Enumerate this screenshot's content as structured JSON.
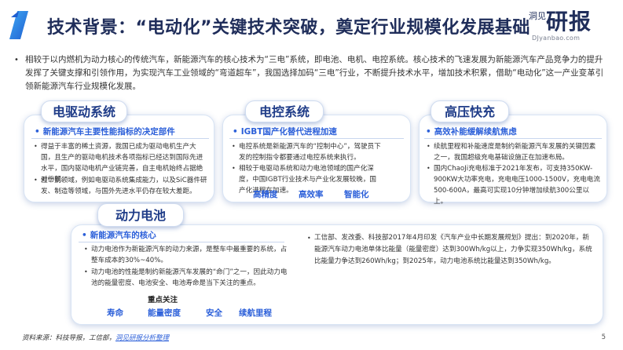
{
  "header": {
    "section_number": "1",
    "title": "技术背景：“电动化”关键技术突破，奠定行业规模化发展基础",
    "logo_small": "洞见",
    "logo_big": "研报",
    "logo_url": "DJyanbao.com"
  },
  "intro": {
    "bullet": "•",
    "text": "相较于以内燃机为动力核心的传统汽车，新能源汽车的核心技术为“三电”系统，即电池、电机、电控系统。核心技术的飞速发展为新能源汽车产品竞争力的提升发挥了关键支撑和引领作用，为实现汽车工业领域的“弯道超车”，我国选择加码“三电”行业，不断提升技术水平，增加技术积累，借助“电动化”这一产业变革引领新能源汽车行业规模化发展。"
  },
  "panels": {
    "motor": {
      "tag": "电驱动系统",
      "subhead": "新能源汽车主要性能指标的决定部件",
      "paragraphs": [
        "得益于丰富的稀土资源，我国已成为驱动电机生产大国，且生产的驱动电机技术各项指标已经达到国际先进水平，国内驱动电机产业链完善，自主电机始终占据绝对份额。",
        "但个别领域，例如电驱动系统集成能力，以及SiC器件研发、制造等领域，与国外先进水平仍存在较大差距。"
      ]
    },
    "control": {
      "tag": "电控系统",
      "subhead": "IGBT国产化替代进程加速",
      "paragraphs": [
        "电控系统是新能源汽车的“控制中心”，驾驶员下发的控制指令都要通过电控系统来执行。",
        "相较于电驱动系统和动力电池领域的国产化深度，中国IGBT行业技术与产业化发展较晚，国产化进程在加速。"
      ],
      "keywords": [
        "高精度",
        "高效率",
        "智能化"
      ]
    },
    "charging": {
      "tag": "高压快充",
      "subhead": "高效补能缓解续航焦虑",
      "paragraphs": [
        "续航里程和补能速度是制约新能源汽车发展的关键因素之一，我国超级充电基础设施正在加速布局。",
        "国内ChaoJi充电标准于2021年发布，可支持350KW-900KW大功率充电，充电电压1000-1500V，充电电流500-600A，最高可实现10分钟增加续航300公里以上。"
      ]
    },
    "battery": {
      "tag": "动力电池",
      "subhead": "新能源汽车的核心",
      "paragraphs_left": [
        "动力电池作为新能源汽车的动力来源，是整车中最重要的系统，占整车成本的30%~40%。",
        "动力电池的性能是制约新能源汽车发展的“命门”之一，因此动力电池的能量密度、电池安全、电池寿命是当下关注的重点。"
      ],
      "paragraph_right": "工信部、发改委、科技部2017年4月印发《汽车产业中长期发展规划》提出：到2020年，新能源汽车动力电池单体比能量（能量密度）达到300Wh/kg以上，力争实现350Wh/kg，系统比能量力争达到260Wh/kg；到2025年，动力电池系统比能量达到350Wh/kg。",
      "focus_label": "重点关注",
      "focus_items": [
        "寿命",
        "能量密度",
        "安全",
        "续航里程"
      ]
    }
  },
  "footer": {
    "source_prefix": "资料来源：科技导报，工信部，",
    "source_link": "洞见研报分析整理",
    "page_number": "5"
  },
  "colors": {
    "accent_blue": "#2b5fd9",
    "navy": "#1f2d5a",
    "tag_text": "#1f3c88"
  }
}
